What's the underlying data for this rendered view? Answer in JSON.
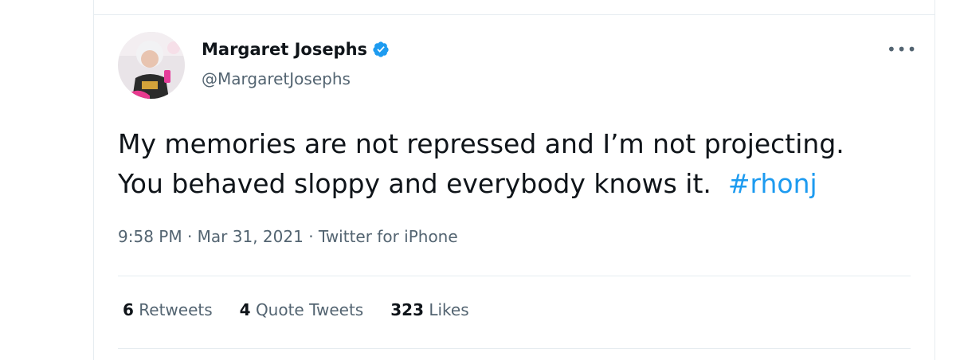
{
  "author": {
    "display_name": "Margaret Josephs",
    "handle": "@MargaretJosephs",
    "verified": true,
    "avatar_icon": "avatar-photo"
  },
  "menu": {
    "more_label": "•••"
  },
  "tweet": {
    "line1": "My memories are not repressed and I’m not projecting.",
    "line2": "You behaved sloppy and everybody knows it.",
    "hashtag": "#rhonj"
  },
  "meta": {
    "time": "9:58 PM",
    "separator": "·",
    "date": "Mar 31, 2021",
    "source": "Twitter for iPhone"
  },
  "stats": {
    "retweets_count": "6",
    "retweets_label": "Retweets",
    "quotes_count": "4",
    "quotes_label": "Quote Tweets",
    "likes_count": "323",
    "likes_label": "Likes"
  },
  "colors": {
    "link": "#1d9bf0",
    "text": "#0f1419",
    "secondary": "#536471",
    "divider": "#e6ecf0"
  }
}
